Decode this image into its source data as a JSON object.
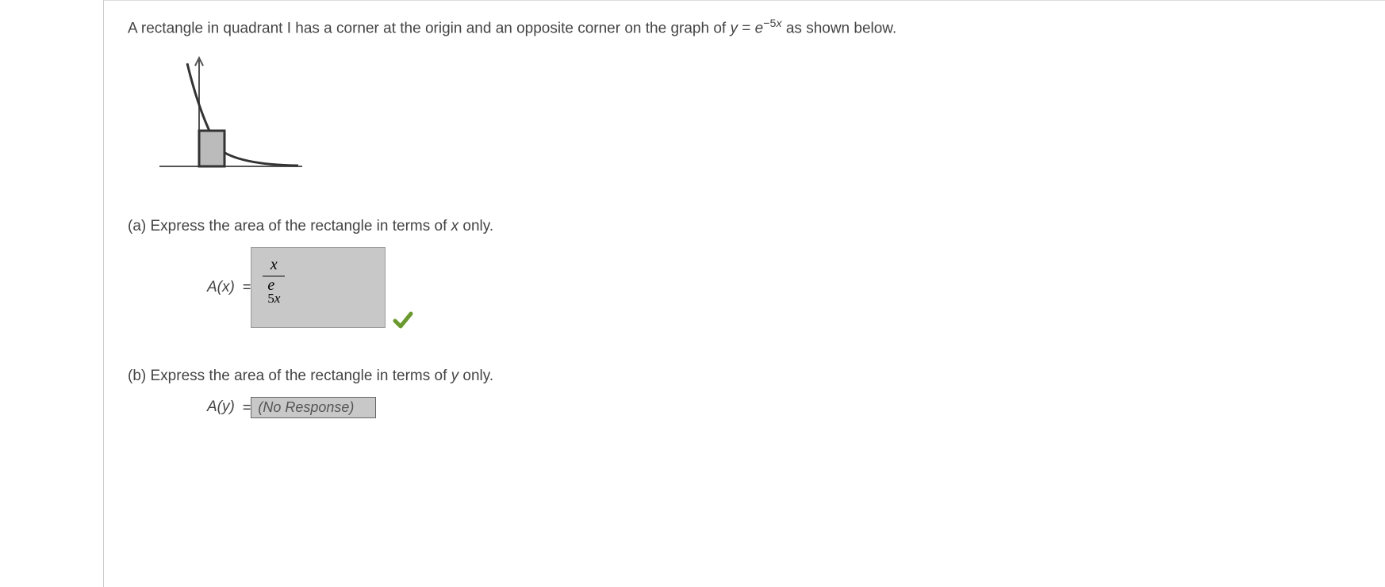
{
  "problem": {
    "intro_pre": "A rectangle in quadrant I has a corner at the origin and an opposite corner on the graph of  ",
    "equation_lhs": "y",
    "equals": " = ",
    "equation_rhs_base": "e",
    "equation_rhs_exp": "−5x",
    "intro_post": "  as shown below."
  },
  "part_a": {
    "label": "(a) Express the area of the rectangle in terms of ",
    "var": "x",
    "label_post": " only.",
    "answer_label": "A(x)",
    "equals": "  =  ",
    "answer_numerator": "x",
    "answer_denom_base": "e",
    "answer_denom_exp": "5x",
    "correct": true
  },
  "part_b": {
    "label": "(b) Express the area of the rectangle in terms of ",
    "var": "y",
    "label_post": " only.",
    "answer_label": "A(y)",
    "equals": "  =  ",
    "placeholder": "(No Response)"
  }
}
